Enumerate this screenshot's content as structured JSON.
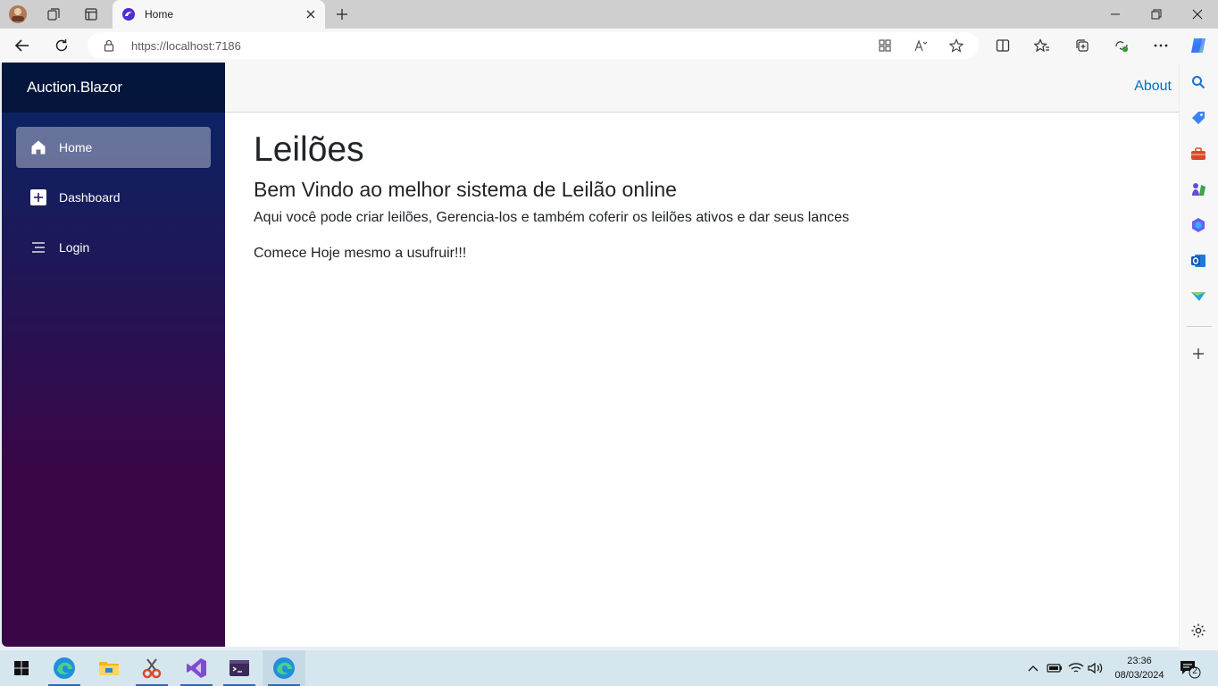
{
  "browser": {
    "tab_title": "Home",
    "url": "https://localhost:7186"
  },
  "app": {
    "brand": "Auction.Blazor",
    "nav": [
      {
        "label": "Home",
        "icon": "home-icon",
        "active": true
      },
      {
        "label": "Dashboard",
        "icon": "plus-square-icon",
        "active": false
      },
      {
        "label": "Login",
        "icon": "list-icon",
        "active": false
      }
    ],
    "top_link": "About"
  },
  "content": {
    "title": "Leilões",
    "subtitle": "Bem Vindo ao melhor sistema de Leilão online",
    "paragraph1": "Aqui você pode criar leilões, Gerencia-los e também coferir os leilões ativos e dar seus lances",
    "paragraph2": "Comece Hoje mesmo a usufruir!!!"
  },
  "taskbar": {
    "time": "23:36",
    "date": "08/03/2024",
    "notification_count": "2"
  },
  "colors": {
    "accent": "#0071c1",
    "sidebar_top": "#052767",
    "sidebar_bottom": "#3a0647"
  }
}
